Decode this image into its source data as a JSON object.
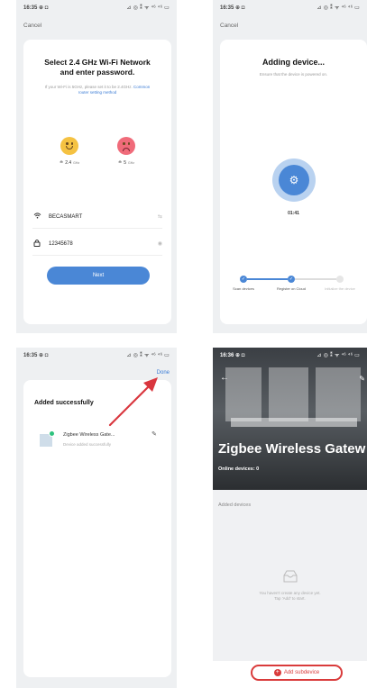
{
  "screen1": {
    "status_time": "16:35 ⊕ ◘",
    "status_icons": "⊿ ◎ ⁑ ᯤ ⁴⁶ ⁴⁶ ▭",
    "cancel": "Cancel",
    "title": "Select 2.4 GHz Wi-Fi Network and enter password.",
    "note": "If your Wi-Fi is 5GHz, please set it to be 2.4GHz.",
    "note_link": "Common router setting method",
    "band_good": "2.4",
    "band_good_unit": "GHz",
    "band_bad": "5",
    "band_bad_unit": "GHz",
    "wifi_name": "BECASMART",
    "password": "12345678",
    "next": "Next"
  },
  "screen2": {
    "status_time": "16:35 ⊕ ◘",
    "status_icons": "⊿ ◎ ⁑ ᯤ ⁴⁶ ⁴⁶ ▭",
    "cancel": "Cancel",
    "title": "Adding device...",
    "subtitle": "Ensure that the device is powered on.",
    "timer": "01:41",
    "steps": [
      {
        "label": "Scan devices",
        "state": "done"
      },
      {
        "label": "Register on Cloud",
        "state": "done"
      },
      {
        "label": "Initialize the device",
        "state": "pending"
      }
    ]
  },
  "screen3": {
    "status_time": "16:35 ⊕ ◘",
    "status_icons": "⊿ ◎ ⁑ ᯤ ⁴⁶ ⁴⁶ ▭",
    "done": "Done",
    "title": "Added successfully",
    "device_name": "Zigbee Wireless Gate...",
    "device_status": "Device added successfully",
    "annotation_color": "#d9363e"
  },
  "screen4": {
    "status_time": "16:36 ⊕ ◘",
    "status_icons": "⊿ ◎ ⁑ ᯤ ⁴⁶ ⁴⁶ ▭",
    "title": "Zigbee Wireless Gatew",
    "online": "Online devices: 0",
    "added_devices": "Added devices",
    "empty_line1": "You haven't create any device yet.",
    "empty_line2": "Tap 'Add' to start.",
    "add_subdevice": "Add subdevice",
    "highlight_color": "#d93b3b"
  },
  "colors": {
    "accent": "#4a87d6",
    "success": "#2ec27e"
  }
}
